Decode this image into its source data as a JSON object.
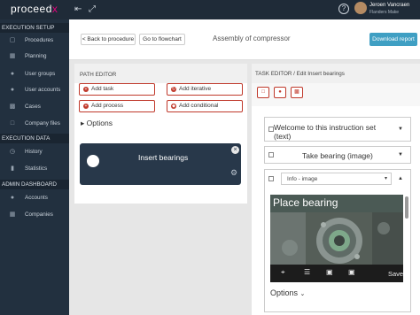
{
  "brand": {
    "logo_text": "pr",
    "logo_mid": "o",
    "logo_tail": "ceed",
    "logo_accent": "x",
    "accent_color": "#e6007e"
  },
  "topbar": {
    "collapse_icon": "menu-collapse-icon",
    "expand_icon": "expand-arrows-icon",
    "help_label": "?",
    "user_name": "Jeroen Vancraen",
    "user_org": "Flanders Make"
  },
  "sidebar": {
    "sections": [
      {
        "title": "EXECUTION SETUP",
        "items": [
          {
            "label": "Procedures",
            "icon": "procedures-icon"
          },
          {
            "label": "Planning",
            "icon": "calendar-icon"
          },
          {
            "label": "User groups",
            "icon": "users-icon"
          },
          {
            "label": "User accounts",
            "icon": "user-icon"
          },
          {
            "label": "Cases",
            "icon": "briefcase-icon"
          },
          {
            "label": "Company files",
            "icon": "folder-icon"
          }
        ]
      },
      {
        "title": "EXECUTION DATA",
        "items": [
          {
            "label": "History",
            "icon": "history-icon"
          },
          {
            "label": "Statistics",
            "icon": "chart-icon"
          }
        ]
      },
      {
        "title": "ADMIN DASHBOARD",
        "items": [
          {
            "label": "Accounts",
            "icon": "accounts-icon"
          },
          {
            "label": "Companies",
            "icon": "building-icon"
          }
        ]
      }
    ]
  },
  "header": {
    "back_label": "< Back to procedure",
    "flowchart_label": "Go to flowchart",
    "title": "Assembly of compressor",
    "download_label": "Download report",
    "download_color": "#3f9fc3"
  },
  "path_editor": {
    "heading": "PATH EDITOR",
    "buttons": {
      "add_task": "Add task",
      "add_iterative": "Add iterative",
      "add_process": "Add process",
      "add_conditional": "Add conditional"
    },
    "options_label": "Options",
    "node": {
      "title": "Insert bearings",
      "close_icon": "close-icon",
      "settings_icon": "gear-icon"
    }
  },
  "task_editor": {
    "heading": "TASK EDITOR / Edit Insert bearings",
    "toolbar_icons": [
      "square-icon",
      "add-icon",
      "save-icon"
    ],
    "steps": [
      {
        "label": "Welcome to this instruction set",
        "label2": "(text)"
      },
      {
        "label": "Take bearing (image)"
      }
    ],
    "active_step": {
      "type_select": "Info - image",
      "image_title": "Place bearing",
      "tools": [
        "crop-icon",
        "align-icon",
        "image-icon",
        "image-icon"
      ],
      "save_label": "Save",
      "options_label": "Options"
    }
  }
}
